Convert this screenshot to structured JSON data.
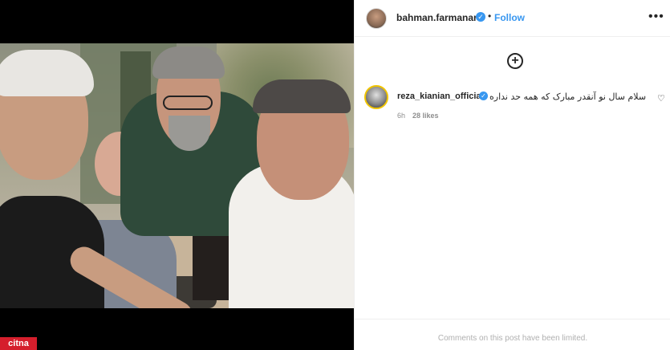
{
  "post": {
    "author": "bahman.farmanara",
    "follow_label": "Follow",
    "separator": "•",
    "more_glyph": "•••",
    "add_glyph": "+"
  },
  "comment": {
    "username": "reza_kianian_official",
    "text": "سلام سال نو آنقدر مبارک که همه حد نداره",
    "time": "6h",
    "likes": "28 likes",
    "heart_glyph": "♡"
  },
  "verified_glyph": "✓",
  "footer": {
    "limited_text": "Comments on this post have been limited."
  },
  "watermark": {
    "text": "citna"
  },
  "colors": {
    "accent": "#3897f0",
    "watermark_bg": "#d51e2c"
  }
}
